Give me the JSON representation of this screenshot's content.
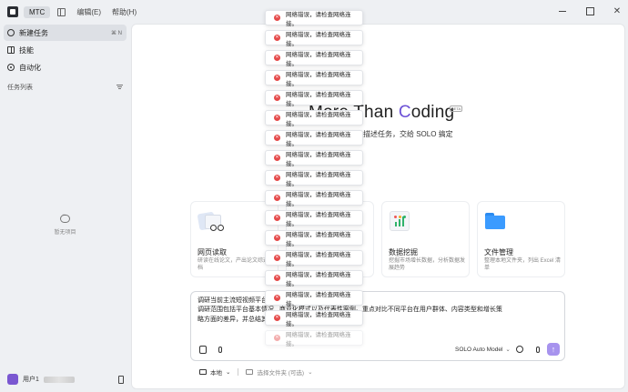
{
  "app": {
    "name": "MTC"
  },
  "menu": {
    "edit": "编辑(E)",
    "help": "帮助(H)"
  },
  "sidebar": {
    "items": [
      {
        "label": "新建任务",
        "shortcut": "⌘ N"
      },
      {
        "label": "技能"
      },
      {
        "label": "自动化"
      }
    ],
    "task_list_label": "任务列表",
    "empty_label": "暂无项目",
    "user_name": "用户1"
  },
  "hero": {
    "title_prefix": "More Than ",
    "title_accent": "C",
    "title_suffix": "oding",
    "badge": "BETA",
    "subtitle": "描述任务，交给 SOLO 搞定"
  },
  "cards": [
    {
      "title": "网页读取",
      "desc": "研读在线论文，产出论文综述文档"
    },
    {
      "title": "数据挖掘",
      "desc": "挖掘市场增长数据，分析数据发展趋势"
    },
    {
      "title": "文件管理",
      "desc": "整理本地文件夹，列出 Excel 清单"
    }
  ],
  "composer": {
    "text_line1": "调研当前主流短视频平台的...汇报的 PPT。",
    "text_line2": "调研范围包括平台基本情况...商业化模式以及代表性案例。重点对比不同平台在用户群体、内容类型和增长策",
    "text_line3": "略方面的差异，并总结其...提供参考。",
    "model": "SOLO Auto Model",
    "location": "本地",
    "folder_placeholder": "选择文件夹 (可选)"
  },
  "toasts": [
    "网络错误，请检查网络连接。",
    "网络错误，请检查网络连接。",
    "网络错误，请检查网络连接。",
    "网络错误，请检查网络连接。",
    "网络错误，请检查网络连接。",
    "网络错误，请检查网络连接。",
    "网络错误，请检查网络连接。",
    "网络错误，请检查网络连接。",
    "网络错误，请检查网络连接。",
    "网络错误，请检查网络连接。",
    "网络错误，请检查网络连接。",
    "网络错误，请检查网络连接。",
    "网络错误，请检查网络连接。",
    "网络错误，请检查网络连接。",
    "网络错误，请检查网络连接。",
    "网络错误，请检查网络连接。",
    "网络错误，请检查网络连接。"
  ],
  "colors": {
    "accent": "#6b50d6",
    "send": "#a793ee",
    "error": "#e54848",
    "avatar": "#7a57d1"
  }
}
